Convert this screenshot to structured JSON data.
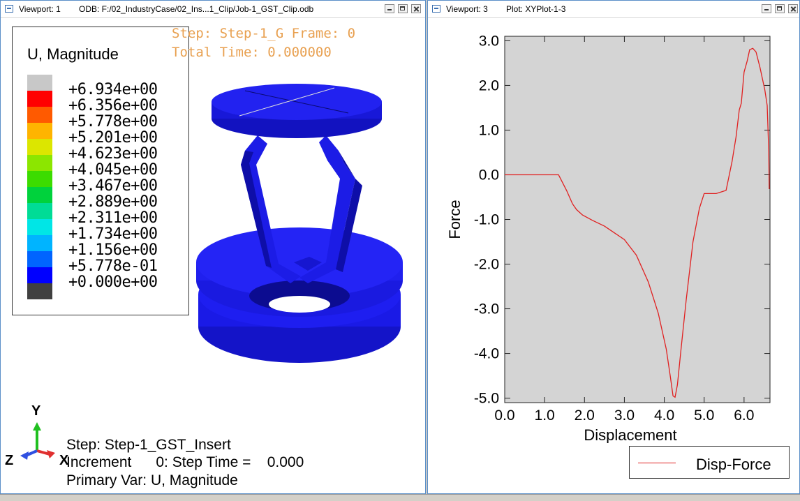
{
  "viewport1": {
    "title": "Viewport: 1",
    "odb": "ODB: F:/02_IndustryCase/02_Ins...1_Clip/Job-1_GST_Clip.odb",
    "legend": {
      "title": "U, Magnitude",
      "values": [
        "+6.934e+00",
        "+6.356e+00",
        "+5.778e+00",
        "+5.201e+00",
        "+4.623e+00",
        "+4.045e+00",
        "+3.467e+00",
        "+2.889e+00",
        "+2.311e+00",
        "+1.734e+00",
        "+1.156e+00",
        "+5.778e-01",
        "+0.000e+00"
      ],
      "colors": [
        "#c8c8c8",
        "#ff0000",
        "#ff5a00",
        "#ffb400",
        "#dce600",
        "#8ce600",
        "#3cdc00",
        "#00d23c",
        "#00dc96",
        "#00e6e6",
        "#00b4ff",
        "#0064ff",
        "#0000ff",
        "#404040"
      ]
    },
    "step_header": {
      "line1": "Step: Step-1_G Frame: 0",
      "line2": "Total Time: 0.000000"
    },
    "info": {
      "line1": "Step: Step-1_GST_Insert",
      "line2": "Increment      0: Step Time =    0.000",
      "line3": "Primary Var: U, Magnitude"
    },
    "triad": {
      "y": "Y",
      "z": "Z",
      "x": "X"
    },
    "model_color": "#1a1aee"
  },
  "viewport3": {
    "title": "Viewport: 3",
    "plot": "Plot: XYPlot-1-3",
    "legend_label": "Disp-Force"
  },
  "chart_data": {
    "type": "line",
    "xlabel": "Displacement",
    "ylabel": "Force",
    "xlim": [
      0,
      6.65
    ],
    "ylim": [
      -5.1,
      3.1
    ],
    "xticks": [
      "0.0",
      "1.0",
      "2.0",
      "3.0",
      "4.0",
      "5.0",
      "6.0"
    ],
    "yticks": [
      "3.0",
      "2.0",
      "1.0",
      "0.0",
      "-1.0",
      "-2.0",
      "-3.0",
      "-4.0",
      "-5.0"
    ],
    "grid": false,
    "background": "#d4d4d4",
    "legend_position": "bottom-right",
    "series": [
      {
        "name": "Disp-Force",
        "color": "#e02020",
        "points": [
          [
            0.0,
            0.0
          ],
          [
            1.35,
            0.0
          ],
          [
            1.55,
            -0.35
          ],
          [
            1.7,
            -0.65
          ],
          [
            1.8,
            -0.78
          ],
          [
            1.95,
            -0.9
          ],
          [
            2.2,
            -1.02
          ],
          [
            2.5,
            -1.15
          ],
          [
            2.75,
            -1.3
          ],
          [
            3.0,
            -1.45
          ],
          [
            3.3,
            -1.8
          ],
          [
            3.6,
            -2.4
          ],
          [
            3.85,
            -3.1
          ],
          [
            4.05,
            -3.9
          ],
          [
            4.15,
            -4.5
          ],
          [
            4.22,
            -4.95
          ],
          [
            4.27,
            -4.98
          ],
          [
            4.33,
            -4.7
          ],
          [
            4.42,
            -3.9
          ],
          [
            4.55,
            -2.8
          ],
          [
            4.72,
            -1.5
          ],
          [
            4.88,
            -0.75
          ],
          [
            5.0,
            -0.42
          ],
          [
            5.3,
            -0.42
          ],
          [
            5.55,
            -0.35
          ],
          [
            5.7,
            0.3
          ],
          [
            5.8,
            0.85
          ],
          [
            5.88,
            1.45
          ],
          [
            5.93,
            1.6
          ],
          [
            6.0,
            2.3
          ],
          [
            6.08,
            2.55
          ],
          [
            6.14,
            2.8
          ],
          [
            6.22,
            2.83
          ],
          [
            6.3,
            2.75
          ],
          [
            6.4,
            2.4
          ],
          [
            6.52,
            1.9
          ],
          [
            6.58,
            1.55
          ],
          [
            6.62,
            0.5
          ],
          [
            6.63,
            -0.32
          ]
        ]
      }
    ]
  }
}
